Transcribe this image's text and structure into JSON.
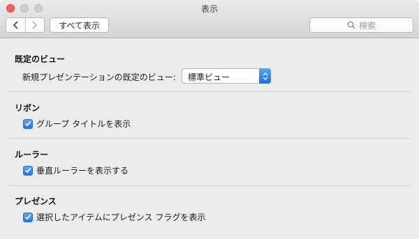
{
  "window": {
    "title": "表示"
  },
  "toolbar": {
    "show_all_label": "すべて表示",
    "search_placeholder": "検索"
  },
  "sections": {
    "default_view": {
      "title": "既定のビュー",
      "row_label": "新規プレゼンテーションの既定のビュー:",
      "selected_value": "標準ビュー"
    },
    "ribbon": {
      "title": "リボン",
      "checkbox_label": "グループ タイトルを表示",
      "checked": true
    },
    "ruler": {
      "title": "ルーラー",
      "checkbox_label": "垂直ルーラーを表示する",
      "checked": true
    },
    "presence": {
      "title": "プレゼンス",
      "checkbox_label": "選択したアイテムにプレゼンス フラグを表示",
      "checked": true
    }
  },
  "colors": {
    "accent": "#1f73e8",
    "close_button": "#fc5f57",
    "window_bg": "#ececec"
  }
}
